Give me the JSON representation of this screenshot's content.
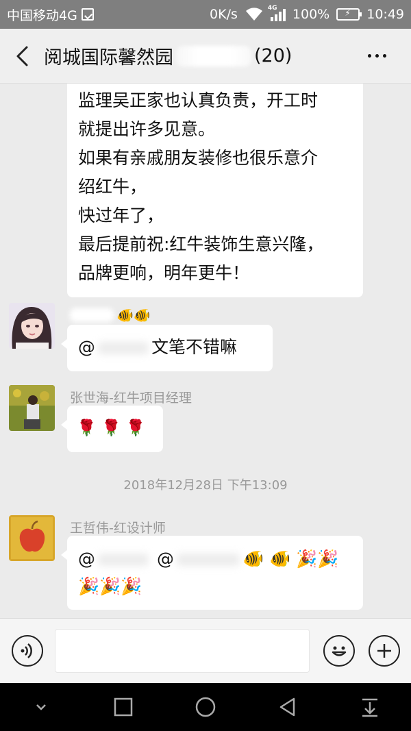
{
  "status_bar": {
    "carrier": "中国移动4G",
    "speed": "0K/s",
    "network_tag": "4G",
    "battery_text": "100%",
    "time": "10:49",
    "battery_color": "#5fcf3a"
  },
  "header": {
    "title": "阅城国际馨然园",
    "member_count": "(20)"
  },
  "messages": {
    "long_text": {
      "lines": [
        "监理吴正家也认真负责，开工时",
        "就提出许多见意。",
        "如果有亲戚朋友装修也很乐意介",
        "绍红牛，",
        "快过年了，",
        "最后提前祝:红牛装饰生意兴隆，",
        "品牌更响，明年更牛！"
      ]
    },
    "msg1": {
      "sender_suffix": "🐠🐠",
      "at": "@",
      "text": "文笔不错嘛"
    },
    "msg2": {
      "sender": "张世海-红牛项目经理",
      "text": "🌹 🌹 🌹"
    },
    "timestamp": "2018年12月28日 下午13:09",
    "msg3": {
      "sender": "王哲伟-红设计师",
      "at1": "@",
      "at2": "@",
      "line1_tail": "🐠 🐠 🎉🎉",
      "line2": "🎉🎉🎉"
    }
  },
  "icons": {
    "back": "back-arrow-icon",
    "more": "more-icon",
    "voice": "voice-icon",
    "emoji": "emoji-icon",
    "add": "add-icon"
  }
}
